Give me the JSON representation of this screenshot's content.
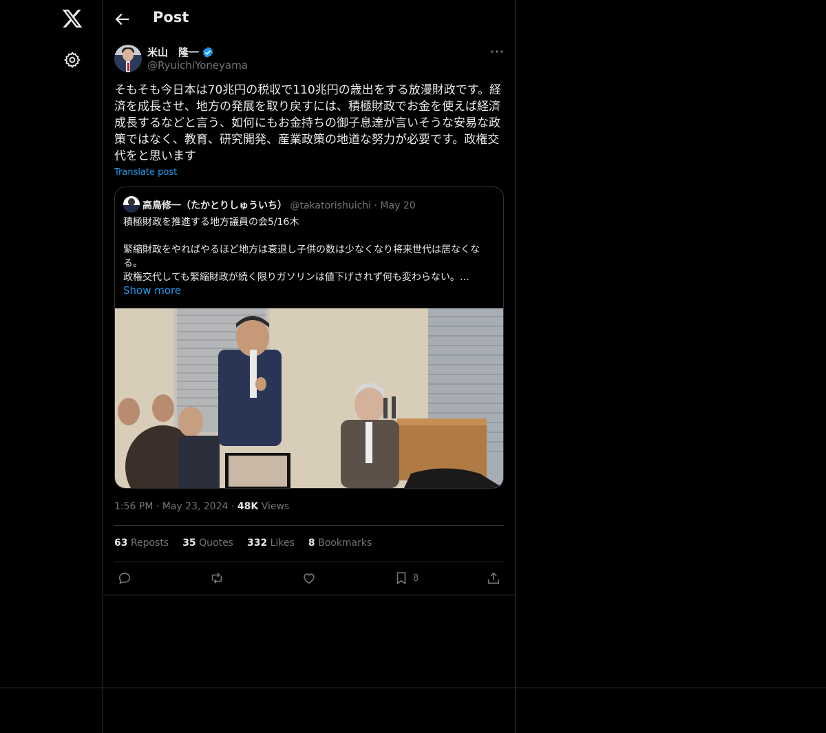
{
  "nav": {
    "logo_icon": "x-logo-icon",
    "settings_icon": "gear-icon"
  },
  "header": {
    "title": "Post",
    "back_icon": "arrow-left-icon"
  },
  "post": {
    "author_name": "米山　隆一",
    "author_handle": "@RyuichiYoneyama",
    "verified": true,
    "text": "そもそも今日本は70兆円の税収で110兆円の歳出をする放漫財政です。経済を成長させ、地方の発展を取り戻すには、積極財政でお金を使えば経済成長するなどと言う、如何にもお金持ちの御子息達が言いそうな安易な政策ではなく、教育、研究開発、産業政策の地道な努力が必要です。政権交代をと思います",
    "translate_label": "Translate post",
    "time": "1:56 PM",
    "date": "May 23, 2024",
    "views_count": "48K",
    "views_label": "Views",
    "sep": "·"
  },
  "quote": {
    "author_name": "高鳥修一（たかとりしゅういち）",
    "author_handle": "@takatorishuichi",
    "date": "May 20",
    "sep": "·",
    "line1": "積極財政を推進する地方議員の会5/16木",
    "line2": "緊縮財政をやればやるほど地方は衰退し子供の数は少なくなり将来世代は居なくなる。",
    "line3": "政権交代しても緊縮財政が続く限りガソリンは値下げされず何も変わらない。…",
    "show_more": "Show more"
  },
  "stats": {
    "reposts_count": "63",
    "reposts_label": "Reposts",
    "quotes_count": "35",
    "quotes_label": "Quotes",
    "likes_count": "332",
    "likes_label": "Likes",
    "bookmarks_count": "8",
    "bookmarks_label": "Bookmarks"
  },
  "actions": {
    "bookmark_count": "8"
  },
  "colors": {
    "background": "#000000",
    "accent": "#1d9bf0",
    "text": "#e7e9ea",
    "muted": "#71767b",
    "border": "#2f3336"
  }
}
